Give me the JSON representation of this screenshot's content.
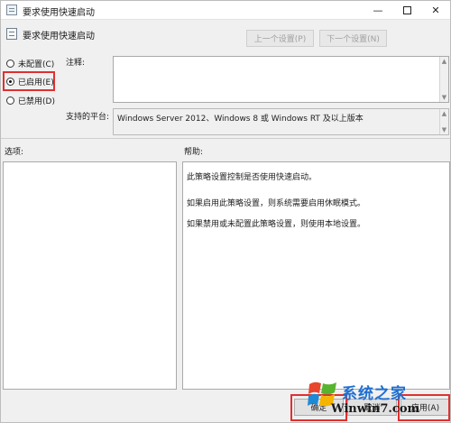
{
  "window": {
    "title": "要求使用快速启动",
    "controls": {
      "minimize": "—",
      "close": "✕"
    }
  },
  "header": {
    "title": "要求使用快速启动",
    "prev_button": "上一个设置(P)",
    "next_button": "下一个设置(N)"
  },
  "state": {
    "options": [
      {
        "label": "未配置(C)",
        "checked": false
      },
      {
        "label": "已启用(E)",
        "checked": true
      },
      {
        "label": "已禁用(D)",
        "checked": false
      }
    ]
  },
  "comment": {
    "label": "注释:",
    "value": ""
  },
  "platform": {
    "label": "支持的平台:",
    "value": "Windows Server 2012、Windows 8 或 Windows RT 及以上版本"
  },
  "options_panel": {
    "label": "选项:"
  },
  "help_panel": {
    "label": "帮助:",
    "lines": [
      "此策略设置控制是否使用快速启动。",
      "如果启用此策略设置，则系统需要启用休眠模式。",
      "如果禁用或未配置此策略设置，则使用本地设置。"
    ]
  },
  "footer": {
    "ok": "确定",
    "cancel": "取消",
    "apply": "应用(A)"
  },
  "watermark": {
    "site": "系统之家",
    "url": "Winwin7.com"
  },
  "colors": {
    "highlight": "#e03030",
    "brand_blue": "#1e6fd0"
  }
}
